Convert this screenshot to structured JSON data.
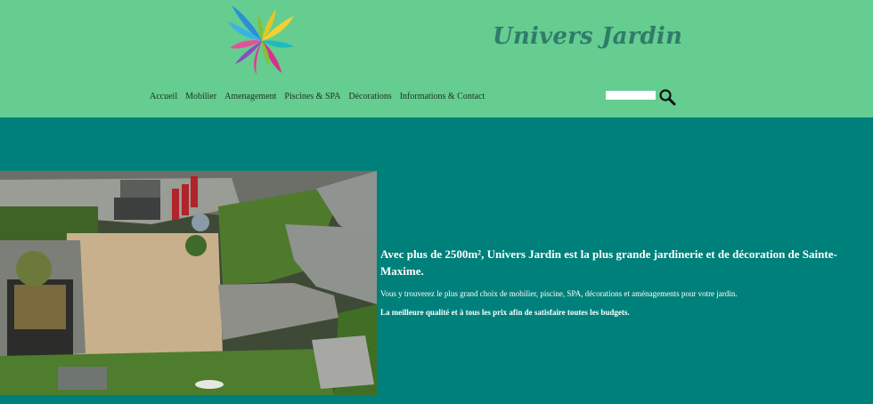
{
  "header": {
    "brand": "Univers Jardin",
    "logo_icon": "colorful-leaves-logo-icon",
    "background_color": "#64cd8f"
  },
  "nav": {
    "items": [
      {
        "label": "Accueil"
      },
      {
        "label": "Mobilier"
      },
      {
        "label": "Amenagement"
      },
      {
        "label": "Piscines & SPA"
      },
      {
        "label": "Décorations"
      },
      {
        "label": "Informations & Contact"
      }
    ]
  },
  "search": {
    "value": "",
    "icon": "search-icon"
  },
  "hero": {
    "image": "garden-landscape-photo"
  },
  "content": {
    "headline": "Avec plus de 2500m², Univers Jardin est la plus grande jardinerie et de décoration de Sainte-Maxime.",
    "description": "Vous y trouverez le plus grand choix de mobilier, piscine, SPA, décorations et aménagements pour votre jardin.",
    "quality": "La meilleure qualité et à tous les prix afin de satisfaire toutes les budgets."
  },
  "colors": {
    "page_background": "#00807a",
    "text": "#ffffff",
    "brand_text": "#2f7c6a"
  }
}
